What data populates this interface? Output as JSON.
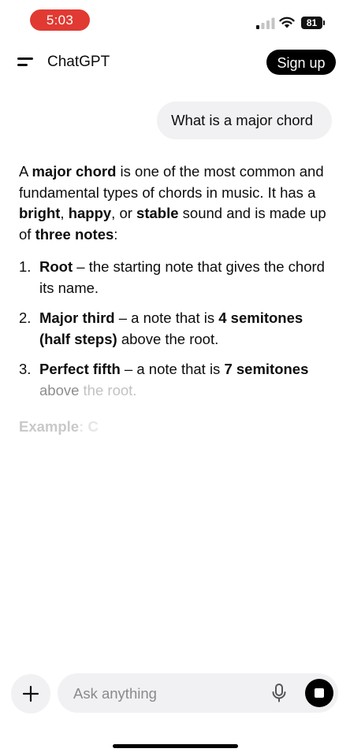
{
  "status_bar": {
    "time": "5:03",
    "battery": "81",
    "signal_icon": "cellular-signal-icon",
    "wifi_icon": "wifi-icon",
    "time_pill_color": "#e03a32"
  },
  "header": {
    "title": "ChatGPT",
    "menu_icon": "menu-icon",
    "signup_label": "Sign up"
  },
  "conversation": {
    "user_message": "What is a major chord",
    "assistant": {
      "intro": {
        "t1": "A ",
        "b1": "major chord",
        "t2": " is one of the most common and fundamental types of chords in music. It has a ",
        "b2": "bright",
        "t3": ", ",
        "b3": "happy",
        "t4": ", or ",
        "b4": "stable",
        "t5": " sound and is made up of ",
        "b5": "three notes",
        "t6": ":"
      },
      "items": [
        {
          "num": "1.",
          "term": "Root",
          "text": " – the starting note that gives the chord its name."
        },
        {
          "num": "2.",
          "term": "Major third",
          "text1": " – a note that is ",
          "bold2": "4 semitones (half steps)",
          "text2": " above the root."
        },
        {
          "num": "3.",
          "term": "Perfect fifth",
          "text1": " – a note that is ",
          "bold2": "7 semitones",
          "text2a": " above",
          "text2b": " the root."
        }
      ],
      "example_label": "Example",
      "example_tail": ": C"
    }
  },
  "composer": {
    "placeholder": "Ask anything",
    "plus_icon": "plus-icon",
    "mic_icon": "microphone-icon",
    "stop_icon": "stop-icon"
  }
}
